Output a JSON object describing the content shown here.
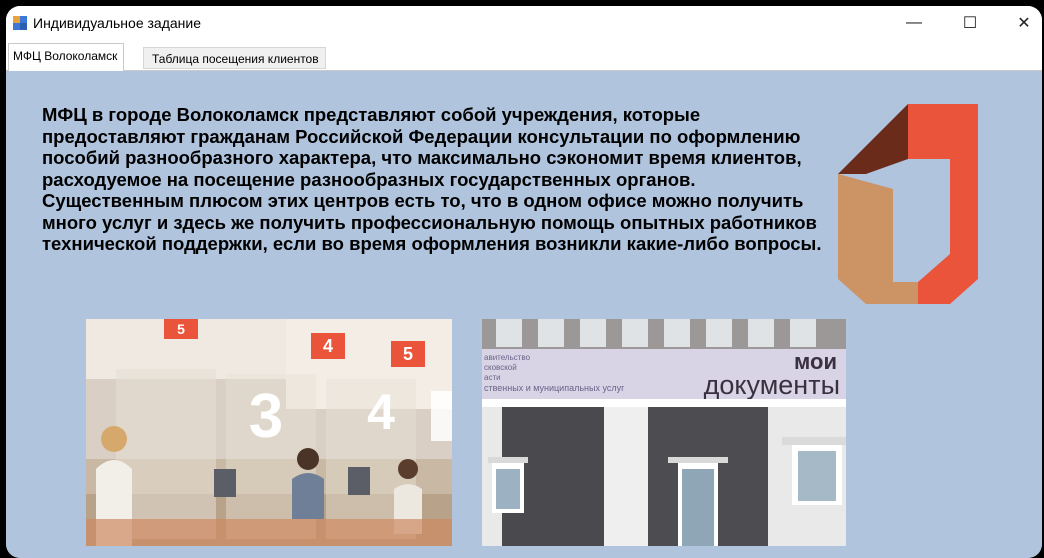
{
  "window": {
    "title": "Индивидуальное задание",
    "controls": {
      "minimize": "—",
      "maximize": "☐",
      "close": "✕"
    }
  },
  "tabs": [
    {
      "label": "МФЦ Волоколамск",
      "active": true
    },
    {
      "label": "Таблица посещения клиентов",
      "active": false
    }
  ],
  "main": {
    "description": "МФЦ в городе Волоколамск представляют собой учреждения, которые предоставляют гражданам Российской Федерации консультации по оформлению пособий разнообразного характера, что максимально сэкономит время клиентов, расходуемое на посещение разнообразных государственных органов. Существенным плюсом этих центров есть то, что в одном офисе можно получить много услуг и здесь же получить профессиональную помощь опытных работников технической поддержки, если во время оформления возникли какие-либо вопросы.",
    "photo_interior": {
      "counter_signs": [
        "5",
        "4",
        "5"
      ],
      "window_numbers": [
        "3",
        "4"
      ]
    },
    "photo_building": {
      "sign_partial_lines": [
        "авительство",
        "сковской",
        "асти",
        "ственных и муниципальных услуг"
      ],
      "brand_line1": "мои",
      "brand_line2": "документы"
    }
  },
  "colors": {
    "window_bg": "#b0c4de",
    "logo_dark": "#6a2b1a",
    "logo_red": "#e9543a",
    "logo_tan": "#cc9365"
  }
}
